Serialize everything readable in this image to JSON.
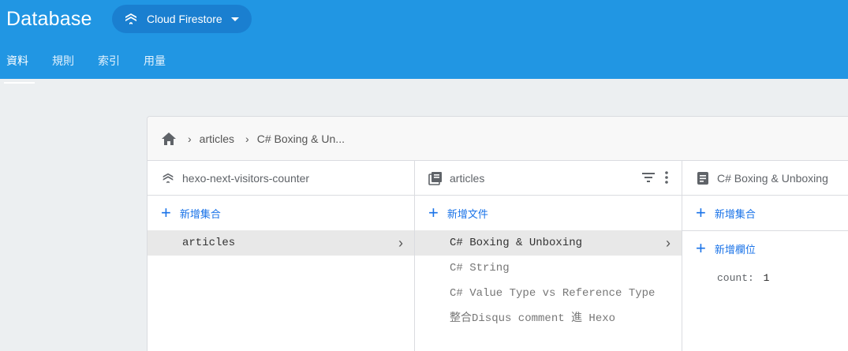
{
  "header": {
    "title": "Database",
    "db_selector": "Cloud Firestore",
    "tabs": [
      "資料",
      "規則",
      "索引",
      "用量"
    ]
  },
  "breadcrumb": [
    "articles",
    "C# Boxing & Un..."
  ],
  "columns": [
    {
      "heading": "hexo-next-visitors-counter",
      "add_label": "新增集合",
      "items": [
        "articles"
      ]
    },
    {
      "heading": "articles",
      "add_label": "新增文件",
      "items": [
        "C# Boxing & Unboxing",
        "C# String",
        "C# Value Type vs Reference Type",
        "整合Disqus comment 進 Hexo"
      ]
    },
    {
      "heading": "C# Boxing & Unboxing",
      "add_collection_label": "新增集合",
      "add_field_label": "新增欄位",
      "fields": [
        {
          "key": "count:",
          "value": "1"
        }
      ]
    }
  ],
  "colors": {
    "header_bg": "#2196e3",
    "accent": "#1a73e8"
  }
}
